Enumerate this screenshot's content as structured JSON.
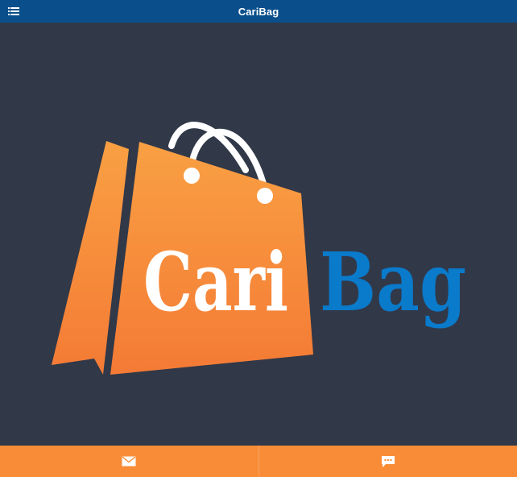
{
  "header": {
    "title": "CariBag",
    "menu_icon": "list-menu-icon"
  },
  "logo": {
    "word1": "Cari",
    "word2": "Bag",
    "colors": {
      "bag_top": "#f9a043",
      "bag_bottom": "#f47a35",
      "word1": "#ffffff",
      "word2": "#0a7acb",
      "handle": "#ffffff"
    }
  },
  "footer": {
    "buttons": [
      {
        "icon": "mail-icon"
      },
      {
        "icon": "chat-icon"
      }
    ]
  },
  "colors": {
    "header_bg": "#0a4f8c",
    "body_bg": "#313848",
    "footer_bg": "#f98d37"
  }
}
